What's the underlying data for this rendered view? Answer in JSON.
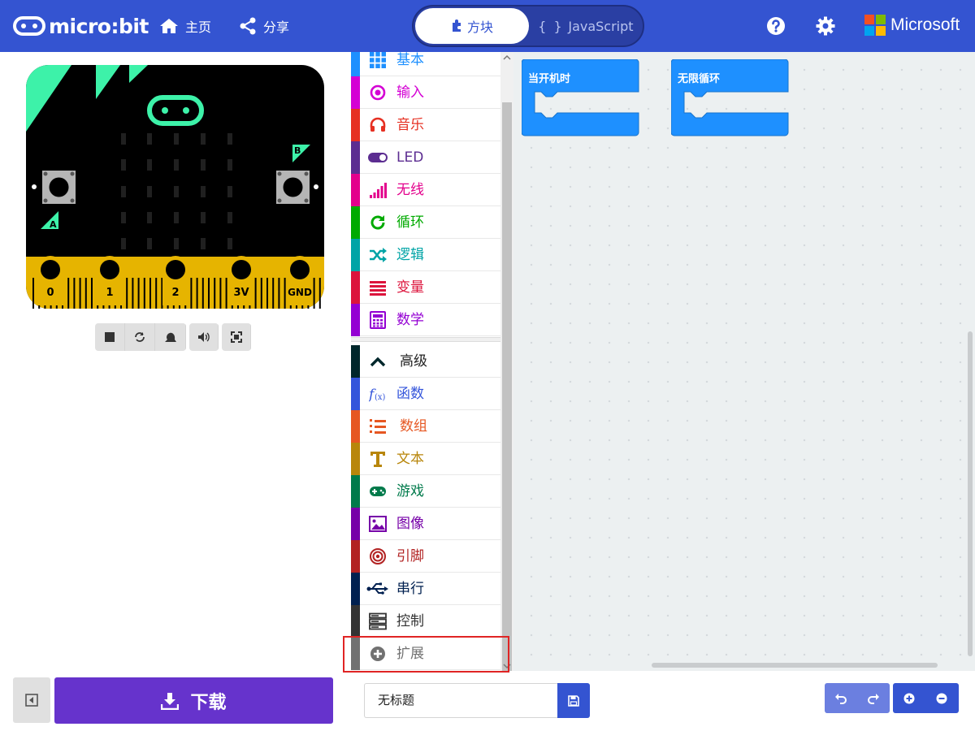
{
  "brand": {
    "name": "micro:bit"
  },
  "nav": {
    "home": "主页",
    "share": "分享"
  },
  "mode": {
    "blocks": "方块",
    "javascript": "JavaScript"
  },
  "vendor": {
    "name": "Microsoft"
  },
  "simulator": {
    "pins": [
      "0",
      "1",
      "2",
      "3V",
      "GND"
    ],
    "button_a": "A",
    "button_b": "B"
  },
  "toolbox": {
    "categories": [
      {
        "label": "基本",
        "color": "#1e90ff",
        "icon": "grid-icon"
      },
      {
        "label": "输入",
        "color": "#d400d4",
        "icon": "target-icon"
      },
      {
        "label": "音乐",
        "color": "#e63022",
        "icon": "headphones-icon"
      },
      {
        "label": "LED",
        "color": "#5c2d91",
        "icon": "toggle-icon"
      },
      {
        "label": "无线",
        "color": "#e3008c",
        "icon": "signal-bars-icon"
      },
      {
        "label": "循环",
        "color": "#00aa00",
        "icon": "refresh-icon"
      },
      {
        "label": "逻辑",
        "color": "#00a4a6",
        "icon": "shuffle-icon"
      },
      {
        "label": "变量",
        "color": "#dc143c",
        "icon": "lines-icon"
      },
      {
        "label": "数学",
        "color": "#9400d3",
        "icon": "calculator-icon"
      }
    ],
    "advanced": {
      "label": "高级",
      "color": "#00272b"
    },
    "advanced_categories": [
      {
        "label": "函数",
        "color": "#3455db",
        "icon": "function-icon"
      },
      {
        "label": "数组",
        "color": "#e65722",
        "icon": "numbered-list-icon"
      },
      {
        "label": "文本",
        "color": "#b8860b",
        "icon": "text-icon"
      },
      {
        "label": "游戏",
        "color": "#007a4b",
        "icon": "gamepad-icon"
      },
      {
        "label": "图像",
        "color": "#7600a8",
        "icon": "image-icon"
      },
      {
        "label": "引脚",
        "color": "#b22222",
        "icon": "bullseye-icon"
      },
      {
        "label": "串行",
        "color": "#002050",
        "icon": "usb-icon"
      },
      {
        "label": "控制",
        "color": "#333333",
        "icon": "server-icon"
      },
      {
        "label": "扩展",
        "color": "#717171",
        "icon": "plus-circle-icon"
      }
    ]
  },
  "workspace": {
    "blocks": [
      {
        "label": "当开机时",
        "color": "#1e90ff"
      },
      {
        "label": "无限循环",
        "color": "#1e90ff"
      }
    ]
  },
  "bottom": {
    "download": "下载",
    "project_name": "无标题"
  }
}
